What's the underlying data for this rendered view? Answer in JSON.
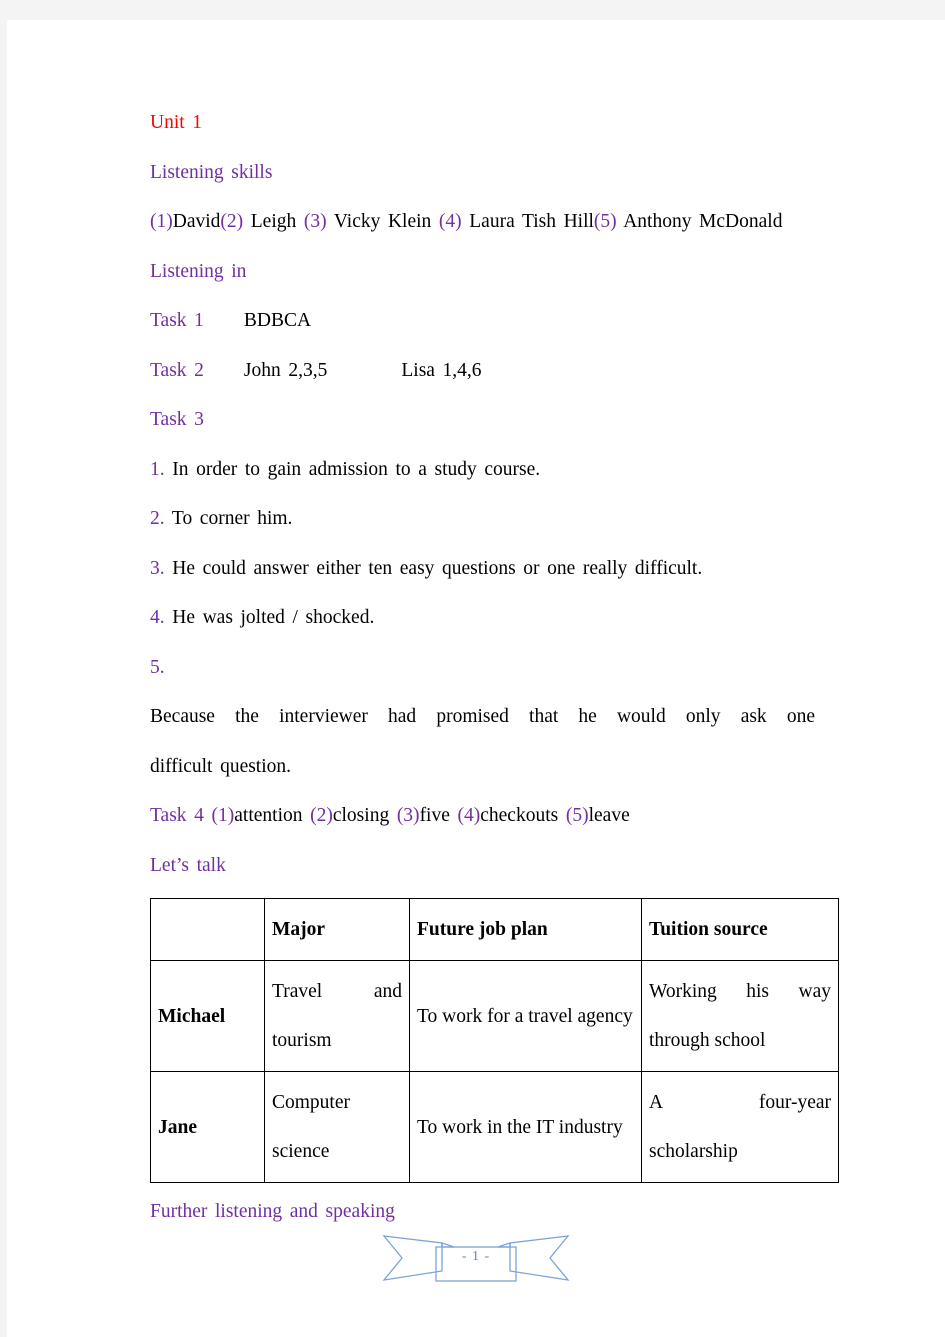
{
  "document": {
    "unit_title": "Unit 1",
    "colors": {
      "unit_title": "#ff0000",
      "heading": "#7030a0",
      "body": "#000000",
      "ribbon": "#5b88c4",
      "gutter": "#f4f4f4"
    }
  },
  "sections": {
    "listening_skills": {
      "heading": "Listening skills",
      "answers": [
        {
          "num": "(1)",
          "text": "David"
        },
        {
          "num": "(2)",
          "text": "Leigh"
        },
        {
          "num": "(3)",
          "text": "Vicky Klein"
        },
        {
          "num": "(4)",
          "text": "Laura Tish Hill"
        },
        {
          "num": "(5)",
          "text": "Anthony McDonald"
        }
      ]
    },
    "listening_in": {
      "heading": "Listening in",
      "task1": {
        "label": "Task 1",
        "answer": "BDBCA"
      },
      "task2": {
        "label": "Task 2",
        "john_label": "John",
        "john_answer": "2,3,5",
        "lisa_label": "Lisa",
        "lisa_answer": "1,4,6"
      },
      "task3": {
        "label": "Task 3",
        "items": [
          {
            "num": "1.",
            "text": "In order to gain admission to a study course."
          },
          {
            "num": "2.",
            "text": "To corner him."
          },
          {
            "num": "3.",
            "text": "He could answer either ten easy questions or one really difficult."
          },
          {
            "num": "4.",
            "text": "He was jolted / shocked."
          },
          {
            "num": "5.",
            "text": "Because the interviewer had promised that he would only ask one",
            "text2": "difficult question."
          }
        ]
      },
      "task4": {
        "label": "Task 4",
        "answers": [
          {
            "num": "(1)",
            "text": "attention"
          },
          {
            "num": "(2)",
            "text": "closing"
          },
          {
            "num": "(3)",
            "text": "five"
          },
          {
            "num": "(4)",
            "text": "checkouts"
          },
          {
            "num": "(5)",
            "text": "leave"
          }
        ]
      }
    },
    "lets_talk": {
      "heading": "Let’s talk",
      "table": {
        "columns": [
          "",
          "Major",
          "Future job plan",
          "Tuition source"
        ],
        "rows": [
          {
            "name": "Michael",
            "major": "Travel and tourism",
            "future_job_plan": "To work for a travel agency",
            "tuition_source": "Working his way through school"
          },
          {
            "name": "Jane",
            "major": "Computer science",
            "future_job_plan": "To work in the IT industry",
            "tuition_source": "A four-year scholarship"
          }
        ]
      }
    },
    "further": {
      "heading": "Further listening and speaking"
    }
  },
  "footer": {
    "page_number": "- 1 -"
  }
}
